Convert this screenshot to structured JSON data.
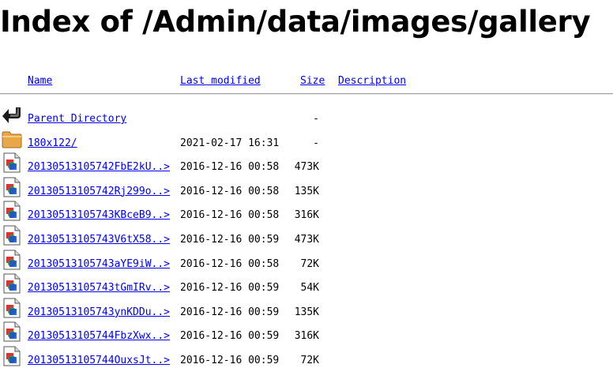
{
  "title": "Index of /Admin/data/images/gallery",
  "columns": {
    "name": "Name",
    "last_modified": "Last modified",
    "size": "Size",
    "description": "Description"
  },
  "rows": [
    {
      "icon": "back-icon",
      "name": "Parent Directory",
      "date": "",
      "size": "-"
    },
    {
      "icon": "folder-icon",
      "name": "180x122/",
      "date": "2021-02-17 16:31",
      "size": "-"
    },
    {
      "icon": "image-file-icon",
      "name": "20130513105742FbE2kU..>",
      "date": "2016-12-16 00:58",
      "size": "473K"
    },
    {
      "icon": "image-file-icon",
      "name": "20130513105742Rj299o..>",
      "date": "2016-12-16 00:58",
      "size": "135K"
    },
    {
      "icon": "image-file-icon",
      "name": "20130513105743KBceB9..>",
      "date": "2016-12-16 00:58",
      "size": "316K"
    },
    {
      "icon": "image-file-icon",
      "name": "20130513105743V6tX58..>",
      "date": "2016-12-16 00:59",
      "size": "473K"
    },
    {
      "icon": "image-file-icon",
      "name": "20130513105743aYE9iW..>",
      "date": "2016-12-16 00:58",
      "size": "72K"
    },
    {
      "icon": "image-file-icon",
      "name": "20130513105743tGmIRv..>",
      "date": "2016-12-16 00:59",
      "size": "54K"
    },
    {
      "icon": "image-file-icon",
      "name": "20130513105743ynKDDu..>",
      "date": "2016-12-16 00:59",
      "size": "135K"
    },
    {
      "icon": "image-file-icon",
      "name": "20130513105744FbzXwx..>",
      "date": "2016-12-16 00:59",
      "size": "316K"
    },
    {
      "icon": "image-file-icon",
      "name": "20130513105744OuxsJt..>",
      "date": "2016-12-16 00:59",
      "size": "72K"
    }
  ],
  "colors": {
    "link": "#0000ee",
    "text": "#000000",
    "folder": "#e8a84a"
  }
}
